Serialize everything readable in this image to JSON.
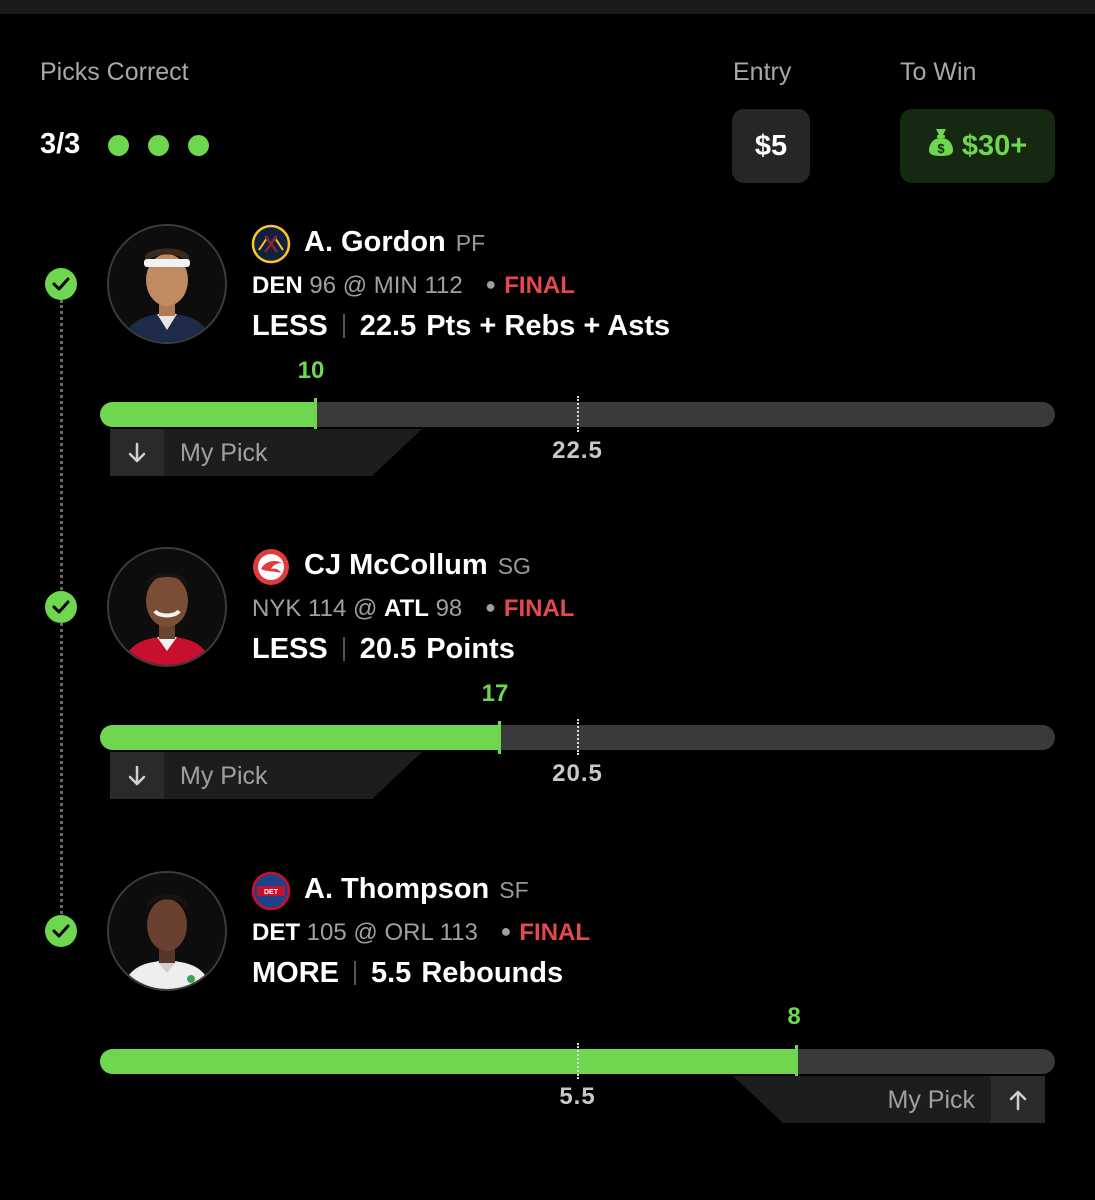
{
  "header": {
    "picks_correct_label": "Picks Correct",
    "picks_correct_value": "3/3",
    "entry_label": "Entry",
    "entry_value": "$5",
    "to_win_label": "To Win",
    "to_win_value": "$30+",
    "to_win_icon": "money-bag-icon"
  },
  "colors": {
    "accent_green": "#6fd64f",
    "final_red": "#e5484d",
    "background": "#000000"
  },
  "picks": [
    {
      "player": "A. Gordon",
      "position": "PF",
      "team_icon": "nuggets-logo",
      "away_team": "DEN",
      "away_score": "96",
      "at": "@",
      "home_team": "MIN",
      "home_score": "112",
      "status": "FINAL",
      "direction": "LESS",
      "line": "22.5",
      "stat": "Pts + Rebs + Asts",
      "actual": "10",
      "actual_fraction": 0.225,
      "line_fraction": 0.5,
      "my_pick_label": "My Pick",
      "result": "correct"
    },
    {
      "player": "CJ McCollum",
      "position": "SG",
      "team_icon": "hawks-logo",
      "away_team": "NYK",
      "away_score": "114",
      "at": "@",
      "home_team": "ATL",
      "home_score": "98",
      "status": "FINAL",
      "direction": "LESS",
      "line": "20.5",
      "stat": "Points",
      "actual": "17",
      "actual_fraction": 0.418,
      "line_fraction": 0.5,
      "my_pick_label": "My Pick",
      "result": "correct"
    },
    {
      "player": "A. Thompson",
      "position": "SF",
      "team_icon": "pistons-logo",
      "away_team": "DET",
      "away_score": "105",
      "at": "@",
      "home_team": "ORL",
      "home_score": "113",
      "status": "FINAL",
      "direction": "MORE",
      "line": "5.5",
      "stat": "Rebounds",
      "actual": "8",
      "actual_fraction": 0.729,
      "line_fraction": 0.5,
      "my_pick_label": "My Pick",
      "result": "correct"
    }
  ]
}
